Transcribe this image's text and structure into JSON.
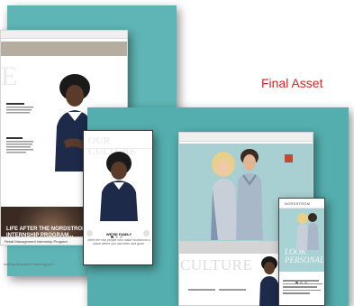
{
  "label": {
    "text": "Final Asset",
    "color": "#e02020"
  },
  "desktop_left": {
    "culture_fragment": "E",
    "footer_text": "Retail Management Internship Program",
    "footer_note": "looking forward to meeting you!",
    "banner": {
      "headline": "LIFE AFTER THE NORDSTROM INTERNSHIP PROGRAM..."
    }
  },
  "phone_left": {
    "header": "OUR CULTURE",
    "caption_title": "WE'RE FAMILY",
    "caption_body": "Meet the real people who make Nordstrom a place where you can learn and grow."
  },
  "desktop_right": {
    "culture_heading": "CULTURE"
  },
  "phone_right": {
    "brand": "NORDSTROM",
    "tagline": "LOOK PERSONAL"
  },
  "icons": {
    "play": "play-icon",
    "arrow_left": "chevron-left-icon",
    "arrow_right": "chevron-right-icon"
  },
  "colors": {
    "teal": "#5fb5b5",
    "banner_dark": "#3a2a22"
  }
}
